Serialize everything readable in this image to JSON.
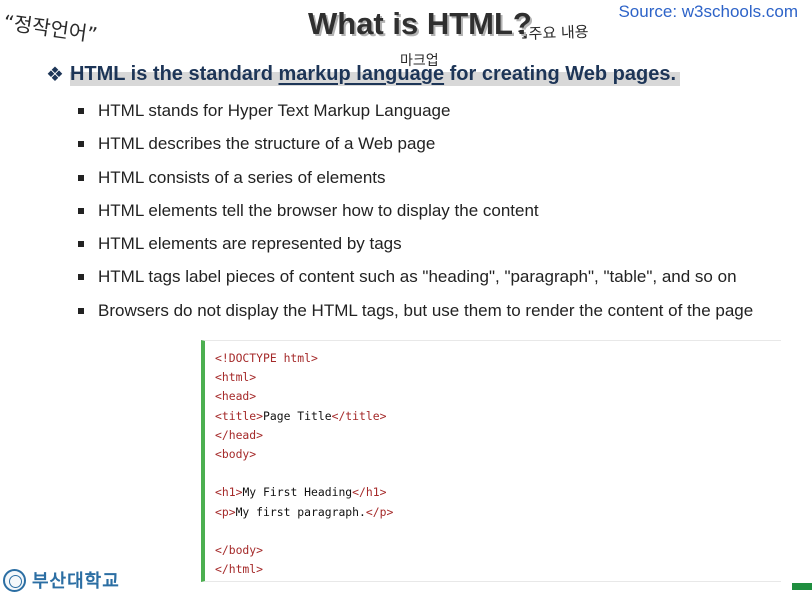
{
  "annotations": {
    "top_left": "“정작언어”",
    "main_note": "↘주요 내용",
    "markup_note": "마크업"
  },
  "header": {
    "title": "What is HTML?",
    "source": "Source: w3schools.com"
  },
  "main_point": {
    "bullet_icon": "❖",
    "text_before": "HTML is the standard ",
    "underlined": "markup language",
    "text_after": " for creating Web pages."
  },
  "bullets": [
    "HTML stands for Hyper Text Markup Language",
    "HTML describes the structure of a Web page",
    "HTML consists of a series of elements",
    "HTML elements tell the browser how to display the content",
    "HTML elements are represented by tags",
    "HTML tags label pieces of content such as \"heading\", \"paragraph\", \"table\", and so on",
    "Browsers do not display the HTML tags, but use them to render the content of the page"
  ],
  "code": {
    "line1": "<!DOCTYPE html>",
    "line2": "<html>",
    "line3": "<head>",
    "line4_open": "<title>",
    "line4_text": "Page Title",
    "line4_close": "</title>",
    "line5": "</head>",
    "line6": "<body>",
    "line8_open": "<h1>",
    "line8_text": "My First Heading",
    "line8_close": "</h1>",
    "line9_open": "<p>",
    "line9_text": "My first paragraph.",
    "line9_close": "</p>",
    "line11": "</body>",
    "line12": "</html>"
  },
  "footer": {
    "logo_text": "부산대학교"
  },
  "colors": {
    "title_text": "#2f2f2f",
    "source_link": "#2d63c8",
    "main_point": "#1d3557",
    "code_border": "#4caf50",
    "code_tag": "#a52a2a",
    "logo": "#2b6ea3"
  },
  "icons": {
    "main_point_bullet": "diamond-bullet-icon",
    "university_logo": "university-seal-icon"
  }
}
